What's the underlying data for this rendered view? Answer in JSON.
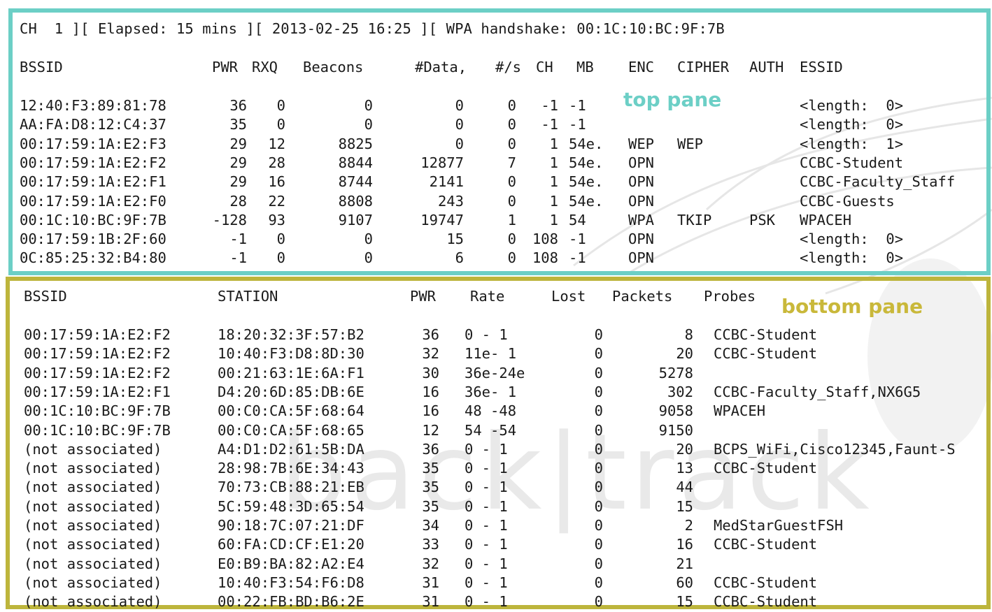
{
  "status_line": "CH  1 ][ Elapsed: 15 mins ][ 2013-02-25 16:25 ][ WPA handshake: 00:1C:10:BC:9F:7B",
  "top_pane": {
    "label": "top pane",
    "headers": [
      "BSSID",
      "PWR",
      "RXQ",
      "Beacons",
      "#Data,",
      "#/s",
      "CH",
      "MB",
      "ENC",
      "CIPHER",
      "AUTH",
      "ESSID"
    ],
    "rows": [
      [
        "12:40:F3:89:81:78",
        "36",
        "0",
        "0",
        "0",
        "0",
        "-1",
        "-1",
        "",
        "",
        "",
        "<length:  0>"
      ],
      [
        "AA:FA:D8:12:C4:37",
        "35",
        "0",
        "0",
        "0",
        "0",
        "-1",
        "-1",
        "",
        "",
        "",
        "<length:  0>"
      ],
      [
        "00:17:59:1A:E2:F3",
        "29",
        "12",
        "8825",
        "0",
        "0",
        "1",
        "54e.",
        "WEP",
        "WEP",
        "",
        "<length:  1>"
      ],
      [
        "00:17:59:1A:E2:F2",
        "29",
        "28",
        "8844",
        "12877",
        "7",
        "1",
        "54e.",
        "OPN",
        "",
        "",
        "CCBC-Student"
      ],
      [
        "00:17:59:1A:E2:F1",
        "29",
        "16",
        "8744",
        "2141",
        "0",
        "1",
        "54e.",
        "OPN",
        "",
        "",
        "CCBC-Faculty_Staff"
      ],
      [
        "00:17:59:1A:E2:F0",
        "28",
        "22",
        "8808",
        "243",
        "0",
        "1",
        "54e.",
        "OPN",
        "",
        "",
        "CCBC-Guests"
      ],
      [
        "00:1C:10:BC:9F:7B",
        "-128",
        "93",
        "9107",
        "19747",
        "1",
        "1",
        "54",
        "WPA",
        "TKIP",
        "PSK",
        "WPACEH"
      ],
      [
        "00:17:59:1B:2F:60",
        "-1",
        "0",
        "0",
        "15",
        "0",
        "108",
        "-1",
        "OPN",
        "",
        "",
        "<length:  0>"
      ],
      [
        "0C:85:25:32:B4:80",
        "-1",
        "0",
        "0",
        "6",
        "0",
        "108",
        "-1",
        "OPN",
        "",
        "",
        "<length:  0>"
      ]
    ]
  },
  "bottom_pane": {
    "label": "bottom pane",
    "headers": [
      "BSSID",
      "STATION",
      "PWR",
      "Rate",
      "Lost",
      "Packets",
      "Probes"
    ],
    "rows": [
      [
        "00:17:59:1A:E2:F2",
        "18:20:32:3F:57:B2",
        "36",
        "0 - 1",
        "0",
        "8",
        "CCBC-Student"
      ],
      [
        "00:17:59:1A:E2:F2",
        "10:40:F3:D8:8D:30",
        "32",
        "11e- 1",
        "0",
        "20",
        "CCBC-Student"
      ],
      [
        "00:17:59:1A:E2:F2",
        "00:21:63:1E:6A:F1",
        "30",
        "36e-24e",
        "0",
        "5278",
        ""
      ],
      [
        "00:17:59:1A:E2:F1",
        "D4:20:6D:85:DB:6E",
        "16",
        "36e- 1",
        "0",
        "302",
        "CCBC-Faculty_Staff,NX6G5"
      ],
      [
        "00:1C:10:BC:9F:7B",
        "00:C0:CA:5F:68:64",
        "16",
        "48 -48",
        "0",
        "9058",
        "WPACEH"
      ],
      [
        "00:1C:10:BC:9F:7B",
        "00:C0:CA:5F:68:65",
        "12",
        "54 -54",
        "0",
        "9150",
        ""
      ],
      [
        "(not associated)",
        "A4:D1:D2:61:5B:DA",
        "36",
        "0 - 1",
        "0",
        "20",
        "BCPS_WiFi,Cisco12345,Faunt-S"
      ],
      [
        "(not associated)",
        "28:98:7B:6E:34:43",
        "35",
        "0 - 1",
        "0",
        "13",
        "CCBC-Student"
      ],
      [
        "(not associated)",
        "70:73:CB:88:21:EB",
        "35",
        "0 - 1",
        "0",
        "44",
        ""
      ],
      [
        "(not associated)",
        "5C:59:48:3D:65:54",
        "35",
        "0 - 1",
        "0",
        "15",
        ""
      ],
      [
        "(not associated)",
        "90:18:7C:07:21:DF",
        "34",
        "0 - 1",
        "0",
        "2",
        "MedStarGuestFSH"
      ],
      [
        "(not associated)",
        "60:FA:CD:CF:E1:20",
        "33",
        "0 - 1",
        "0",
        "16",
        "CCBC-Student"
      ],
      [
        "(not associated)",
        "E0:B9:BA:82:A2:E4",
        "32",
        "0 - 1",
        "0",
        "21",
        ""
      ],
      [
        "(not associated)",
        "10:40:F3:54:F6:D8",
        "31",
        "0 - 1",
        "0",
        "60",
        "CCBC-Student"
      ],
      [
        "(not associated)",
        "00:22:FB:BD:B6:2E",
        "31",
        "0 - 1",
        "0",
        "15",
        "CCBC-Student"
      ]
    ]
  },
  "watermark": "back|track",
  "colors": {
    "top_pane_border": "#6ccfc6",
    "bottom_pane_border": "#bdb53c",
    "text": "#1a1a1a"
  }
}
